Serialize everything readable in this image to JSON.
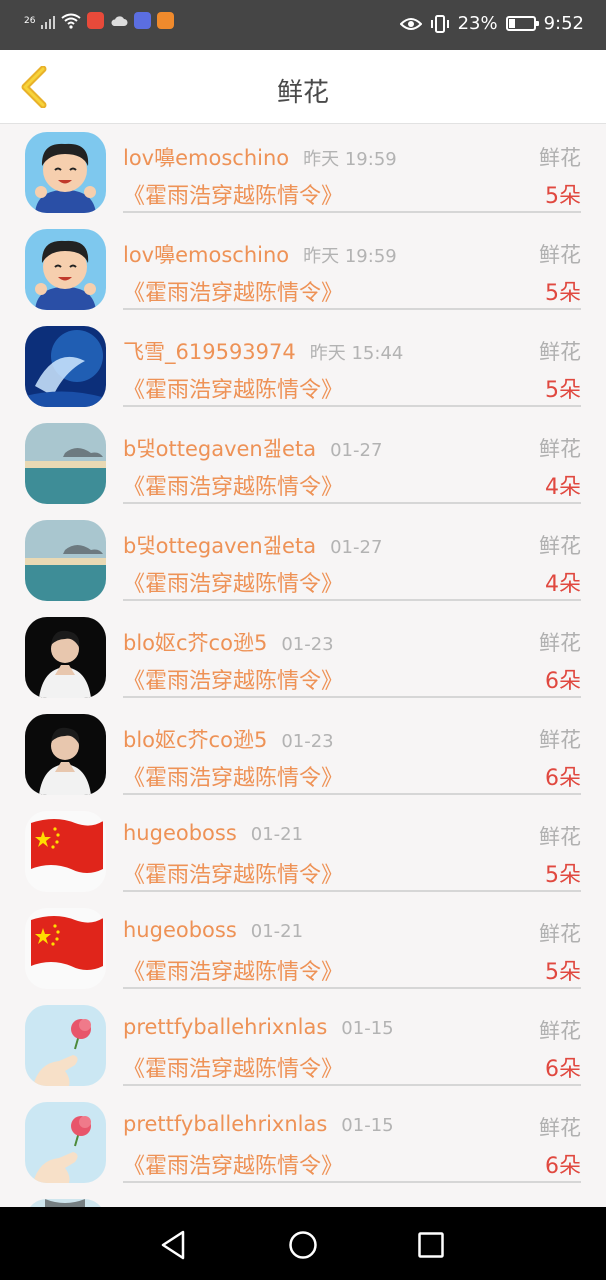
{
  "status_bar": {
    "network": "26",
    "battery": "23%",
    "time": "9:52"
  },
  "header": {
    "title": "鲜花"
  },
  "items": [
    {
      "user": "lov嚊emoschino",
      "time": "昨天 19:59",
      "gift": "鲜花",
      "book": "《霍雨浩穿越陈情令》",
      "count": "5朵",
      "avatar": "cartoon-boy"
    },
    {
      "user": "lov嚊emoschino",
      "time": "昨天 19:59",
      "gift": "鲜花",
      "book": "《霍雨浩穿越陈情令》",
      "count": "5朵",
      "avatar": "cartoon-boy"
    },
    {
      "user": "飞雪_619593974",
      "time": "昨天 15:44",
      "gift": "鲜花",
      "book": "《霍雨浩穿越陈情令》",
      "count": "5朵",
      "avatar": "fantasy"
    },
    {
      "user": "b댗ottegaven겚eta",
      "time": "01-27",
      "gift": "鲜花",
      "book": "《霍雨浩穿越陈情令》",
      "count": "4朵",
      "avatar": "sea"
    },
    {
      "user": "b댗ottegaven겚eta",
      "time": "01-27",
      "gift": "鲜花",
      "book": "《霍雨浩穿越陈情令》",
      "count": "4朵",
      "avatar": "sea"
    },
    {
      "user": "blo妪c芥co逊5",
      "time": "01-23",
      "gift": "鲜花",
      "book": "《霍雨浩穿越陈情令》",
      "count": "6朵",
      "avatar": "portrait"
    },
    {
      "user": "blo妪c芥co逊5",
      "time": "01-23",
      "gift": "鲜花",
      "book": "《霍雨浩穿越陈情令》",
      "count": "6朵",
      "avatar": "portrait"
    },
    {
      "user": "hugeoboss",
      "time": "01-21",
      "gift": "鲜花",
      "book": "《霍雨浩穿越陈情令》",
      "count": "5朵",
      "avatar": "flag"
    },
    {
      "user": "hugeoboss",
      "time": "01-21",
      "gift": "鲜花",
      "book": "《霍雨浩穿越陈情令》",
      "count": "5朵",
      "avatar": "flag"
    },
    {
      "user": "prettfyballehrixnlas",
      "time": "01-15",
      "gift": "鲜花",
      "book": "《霍雨浩穿越陈情令》",
      "count": "6朵",
      "avatar": "flower-hand"
    },
    {
      "user": "prettfyballehrixnlas",
      "time": "01-15",
      "gift": "鲜花",
      "book": "《霍雨浩穿越陈情令》",
      "count": "6朵",
      "avatar": "flower-hand"
    }
  ],
  "colors": {
    "accent": "#ee9256",
    "count_red": "#e0483f",
    "back_arrow": "#e8b12a"
  }
}
